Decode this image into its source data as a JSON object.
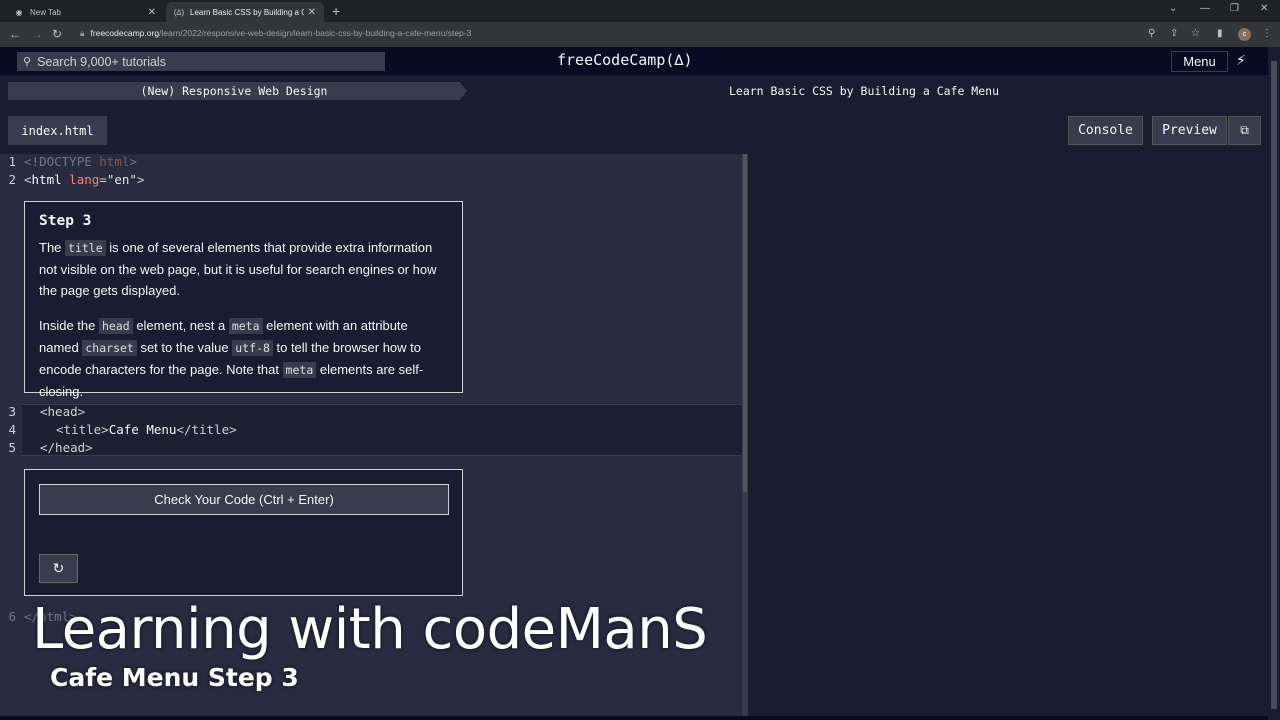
{
  "browser": {
    "tabs": [
      {
        "title": "New Tab",
        "icon": "chrome-icon",
        "active": false
      },
      {
        "title": "Learn Basic CSS by Building a Ca",
        "icon": "fcc-icon",
        "active": true
      }
    ],
    "new_tab_glyph": "+",
    "address": {
      "host": "freecodecamp.org",
      "path": "/learn/2022/responsive-web-design/learn-basic-css-by-building-a-cafe-menu/step-3"
    },
    "profile_initial": "c",
    "window_controls": {
      "minimize": "—",
      "restore": "❐",
      "close": "✕"
    },
    "nav": {
      "back": "←",
      "forward": "→",
      "reload": "↻"
    }
  },
  "fcc_nav": {
    "search_placeholder": "Search 9,000+ tutorials",
    "brand": "freeCodeCamp(🔥)",
    "menu_label": "Menu"
  },
  "breadcrumbs": {
    "superblock": "(New) Responsive Web Design",
    "block": "Learn Basic CSS by Building a Cafe Menu"
  },
  "toolbar": {
    "file_tab": "index.html",
    "console_label": "Console",
    "preview_label": "Preview"
  },
  "editor": {
    "line_numbers": [
      "1",
      "2",
      "3",
      "4",
      "5",
      "6"
    ],
    "lines": {
      "l1": {
        "open": "<!",
        "kw": "DOCTYPE ",
        "name": "html",
        "close": ">"
      },
      "l2": {
        "open": "<",
        "tag": "html",
        "sp": " ",
        "attr": "lang",
        "eq": "=",
        "val": "\"en\"",
        "close": ">"
      },
      "l3": {
        "text": "<head>"
      },
      "l4_open": "<title>",
      "l4_text": "Cafe Menu",
      "l4_close": "</title>",
      "l5": {
        "text": "</head>"
      },
      "l6": {
        "text": "</html>"
      }
    }
  },
  "step": {
    "title": "Step 3",
    "p1_a": "The ",
    "p1_code": "title",
    "p1_b": " is one of several elements that provide extra information not visible on the web page, but it is useful for search engines or how the page gets displayed.",
    "p2_a": "Inside the ",
    "p2_code1": "head",
    "p2_b": " element, nest a ",
    "p2_code2": "meta",
    "p2_c": " element with an attribute named ",
    "p2_code3": "charset",
    "p2_d": " set to the value ",
    "p2_code4": "utf-8",
    "p2_e": " to tell the browser how to encode characters for the page. Note that ",
    "p2_code5": "meta",
    "p2_f": " elements are self-closing."
  },
  "check": {
    "button_label": "Check Your Code (Ctrl + Enter)",
    "reset_icon": "reset-icon"
  },
  "overlay": {
    "title": "Learning with codeManS",
    "subtitle": "Cafe Menu Step 3"
  }
}
